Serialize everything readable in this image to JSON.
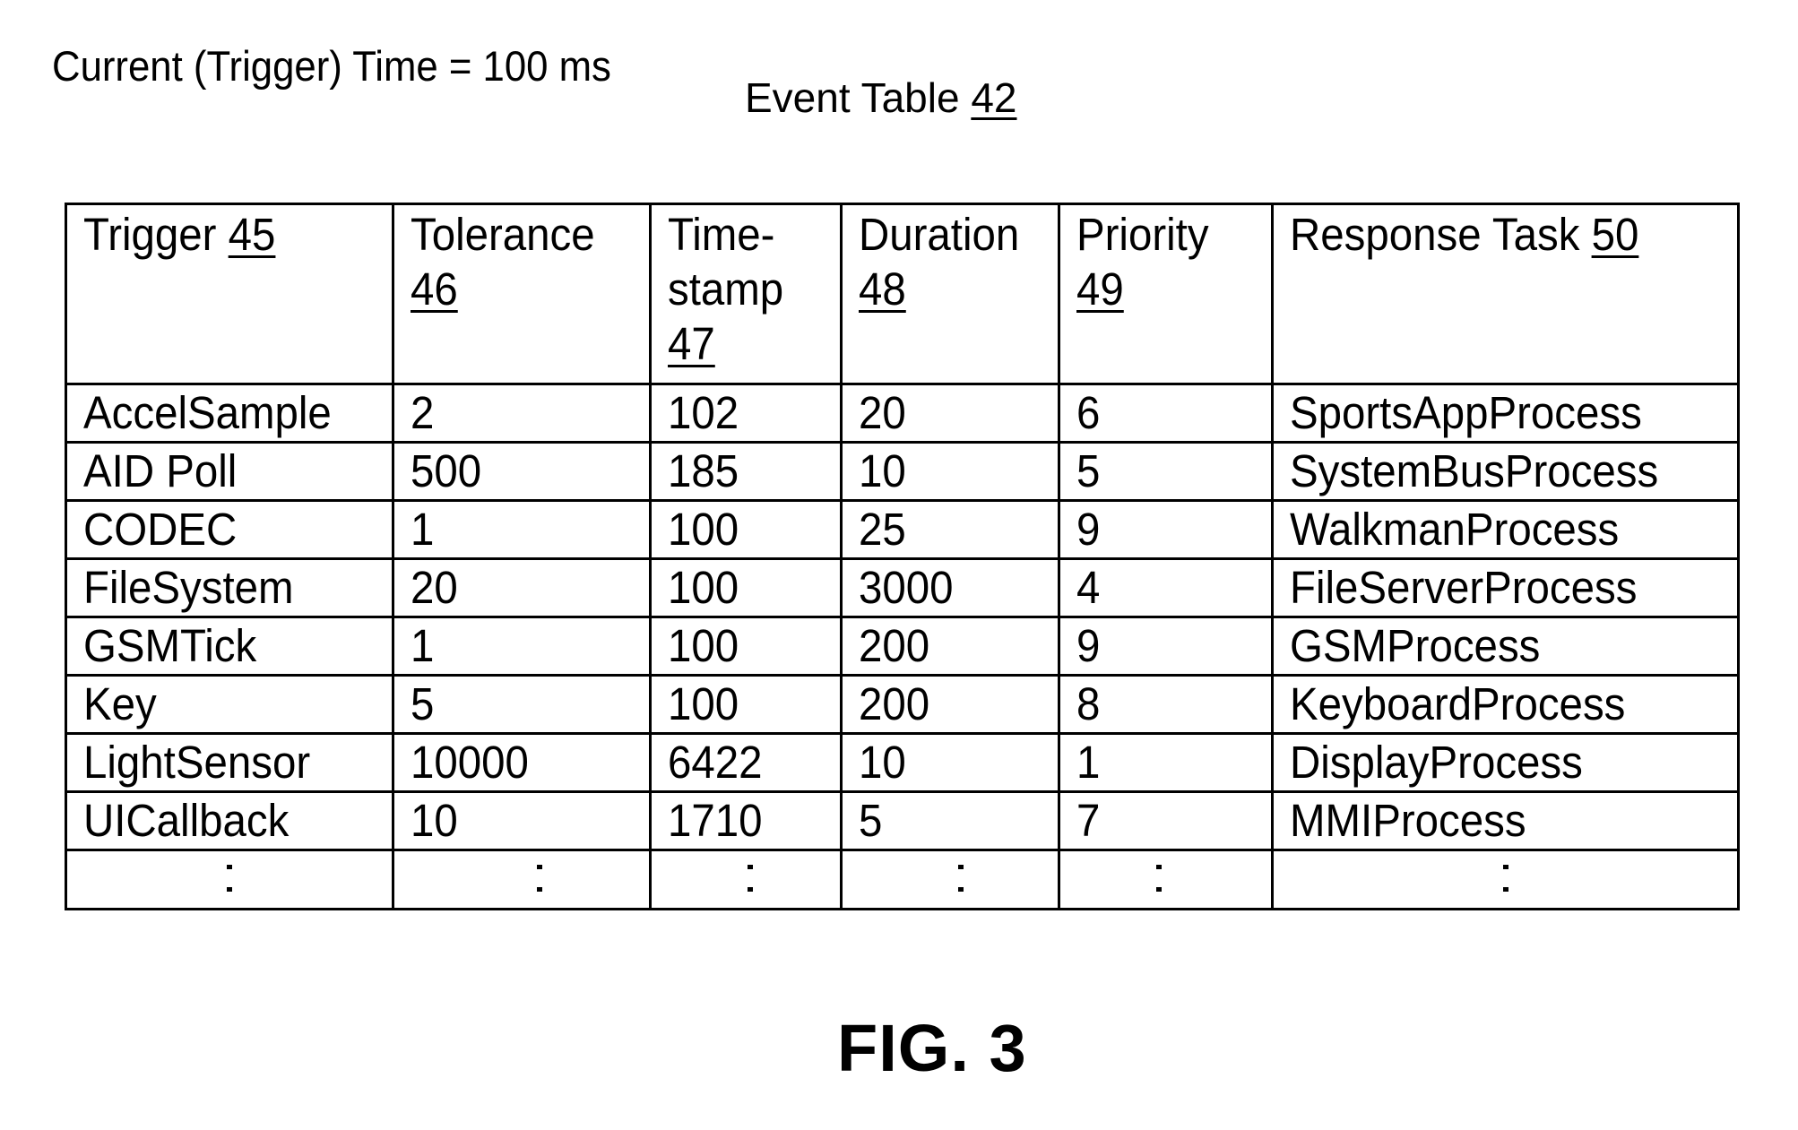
{
  "header": {
    "current_time_label": "Current (Trigger) Time = 100 ms",
    "table_title": "Event Table",
    "table_ref": "42"
  },
  "table": {
    "columns": [
      {
        "lines": [
          "Trigger"
        ],
        "ref": "45",
        "ref_inline": true
      },
      {
        "lines": [
          "Tolerance"
        ],
        "ref": "46",
        "ref_inline": false
      },
      {
        "lines": [
          "Time-",
          "stamp"
        ],
        "ref": "47",
        "ref_inline": false
      },
      {
        "lines": [
          "Duration"
        ],
        "ref": "48",
        "ref_inline": false
      },
      {
        "lines": [
          "Priority"
        ],
        "ref": "49",
        "ref_inline": false
      },
      {
        "lines": [
          "Response Task"
        ],
        "ref": "50",
        "ref_inline": true
      }
    ],
    "rows": [
      [
        "AccelSample",
        "2",
        "102",
        "20",
        "6",
        "SportsAppProcess"
      ],
      [
        "AID Poll",
        "500",
        "185",
        "10",
        "5",
        "SystemBusProcess"
      ],
      [
        "CODEC",
        "1",
        "100",
        "25",
        "9",
        "WalkmanProcess"
      ],
      [
        "FileSystem",
        "20",
        "100",
        "3000",
        "4",
        "FileServerProcess"
      ],
      [
        "GSMTick",
        "1",
        "100",
        "200",
        "9",
        "GSMProcess"
      ],
      [
        "Key",
        "5",
        "100",
        "200",
        "8",
        "KeyboardProcess"
      ],
      [
        "LightSensor",
        "10000",
        "6422",
        "10",
        "1",
        "DisplayProcess"
      ],
      [
        "UICallback",
        "10",
        "1710",
        "5",
        "7",
        "MMIProcess"
      ]
    ],
    "continuation_row": true
  },
  "figure_label": "FIG. 3"
}
